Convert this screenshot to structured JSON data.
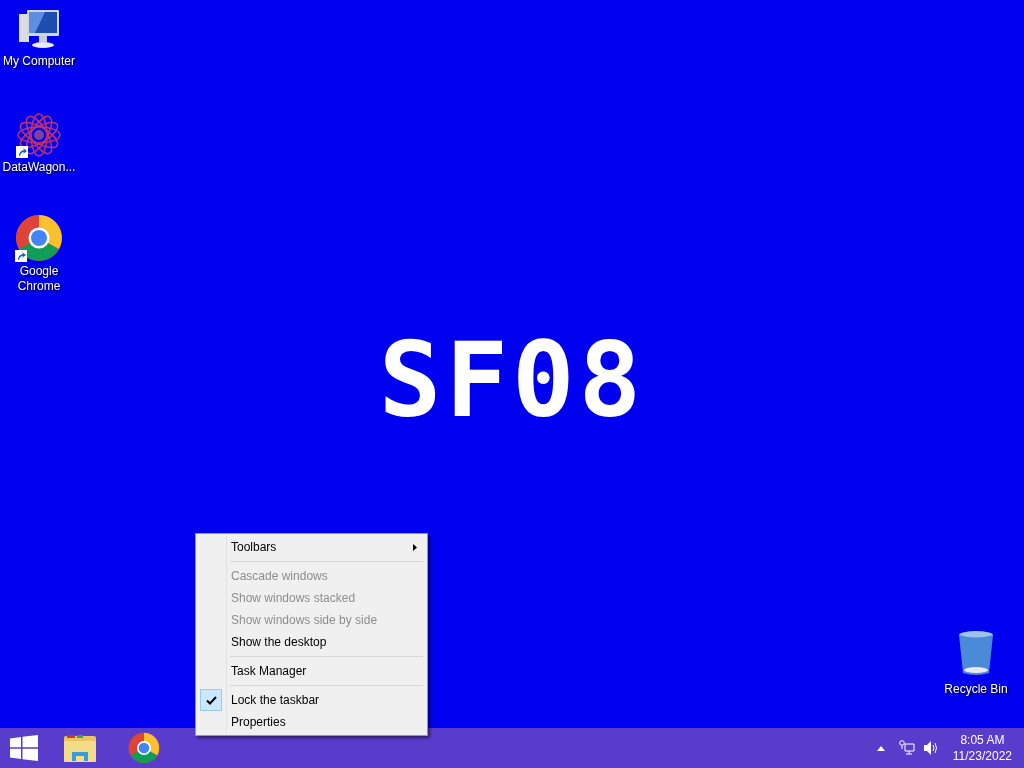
{
  "desktop_icons": [
    {
      "kind": "computer",
      "label": "My Computer",
      "shortcut": false
    },
    {
      "kind": "datawagon",
      "label": "DataWagon...",
      "shortcut": true
    },
    {
      "kind": "chrome",
      "label": "Google Chrome",
      "shortcut": true
    }
  ],
  "wallpaper": {
    "text": "SF08"
  },
  "recycle_bin": {
    "label": "Recycle Bin"
  },
  "context_menu": [
    {
      "kind": "item",
      "label": "Toolbars",
      "disabled": false,
      "checked": false,
      "submenu": true
    },
    {
      "kind": "separator"
    },
    {
      "kind": "item",
      "label": "Cascade windows",
      "disabled": true,
      "checked": false,
      "submenu": false
    },
    {
      "kind": "item",
      "label": "Show windows stacked",
      "disabled": true,
      "checked": false,
      "submenu": false
    },
    {
      "kind": "item",
      "label": "Show windows side by side",
      "disabled": true,
      "checked": false,
      "submenu": false
    },
    {
      "kind": "item",
      "label": "Show the desktop",
      "disabled": false,
      "checked": false,
      "submenu": false
    },
    {
      "kind": "separator"
    },
    {
      "kind": "item",
      "label": "Task Manager",
      "disabled": false,
      "checked": false,
      "submenu": false
    },
    {
      "kind": "separator"
    },
    {
      "kind": "item",
      "label": "Lock the taskbar",
      "disabled": false,
      "checked": true,
      "submenu": false
    },
    {
      "kind": "item",
      "label": "Properties",
      "disabled": false,
      "checked": false,
      "submenu": false
    }
  ],
  "taskbar": {
    "apps": [
      {
        "kind": "start"
      },
      {
        "kind": "explorer"
      },
      {
        "kind": "chrome"
      }
    ],
    "time": "8:05 AM",
    "date": "11/23/2022"
  }
}
